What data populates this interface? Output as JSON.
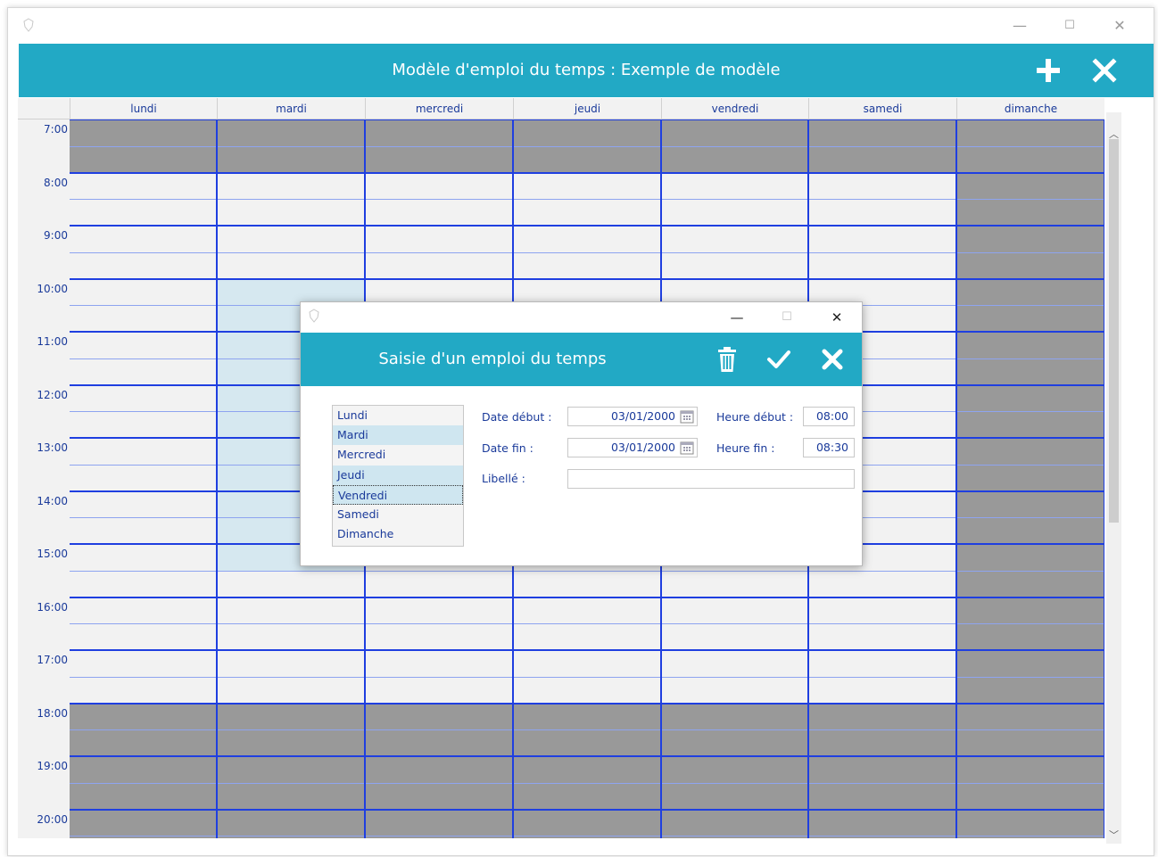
{
  "window": {
    "title": "Modèle d'emploi du temps : Exemple de modèle",
    "controls": {
      "minimize": "—",
      "maximize": "☐",
      "close": "✕"
    }
  },
  "days": [
    "lundi",
    "mardi",
    "mercredi",
    "jeudi",
    "vendredi",
    "samedi",
    "dimanche"
  ],
  "hours": [
    "7:00",
    "8:00",
    "9:00",
    "10:00",
    "11:00",
    "12:00",
    "13:00",
    "14:00",
    "15:00",
    "16:00",
    "17:00",
    "18:00",
    "19:00",
    "20:00"
  ],
  "colors": {
    "accent": "#22a9c5",
    "unavailable": "#999999",
    "available": "#f2f2f2",
    "selection": "#d6e8f0",
    "grid_line": "#1f3fe0",
    "half_line": "#8ea4f0",
    "text": "#1a3a9a"
  },
  "dialog": {
    "title": "Saisie d'un emploi du temps",
    "controls": {
      "minimize": "—",
      "maximize": "☐",
      "close": "✕"
    },
    "day_list": [
      {
        "label": "Lundi",
        "selected": false
      },
      {
        "label": "Mardi",
        "selected": true
      },
      {
        "label": "Mercredi",
        "selected": false
      },
      {
        "label": "Jeudi",
        "selected": true
      },
      {
        "label": "Vendredi",
        "selected": true,
        "focused": true
      },
      {
        "label": "Samedi",
        "selected": false
      },
      {
        "label": "Dimanche",
        "selected": false
      }
    ],
    "date_debut_label": "Date début :",
    "date_debut_value": "03/01/2000",
    "date_fin_label": "Date fin :",
    "date_fin_value": "03/01/2000",
    "heure_debut_label": "Heure début :",
    "heure_debut_value": "08:00",
    "heure_fin_label": "Heure fin :",
    "heure_fin_value": "08:30",
    "libelle_label": "Libellé :",
    "libelle_value": ""
  }
}
